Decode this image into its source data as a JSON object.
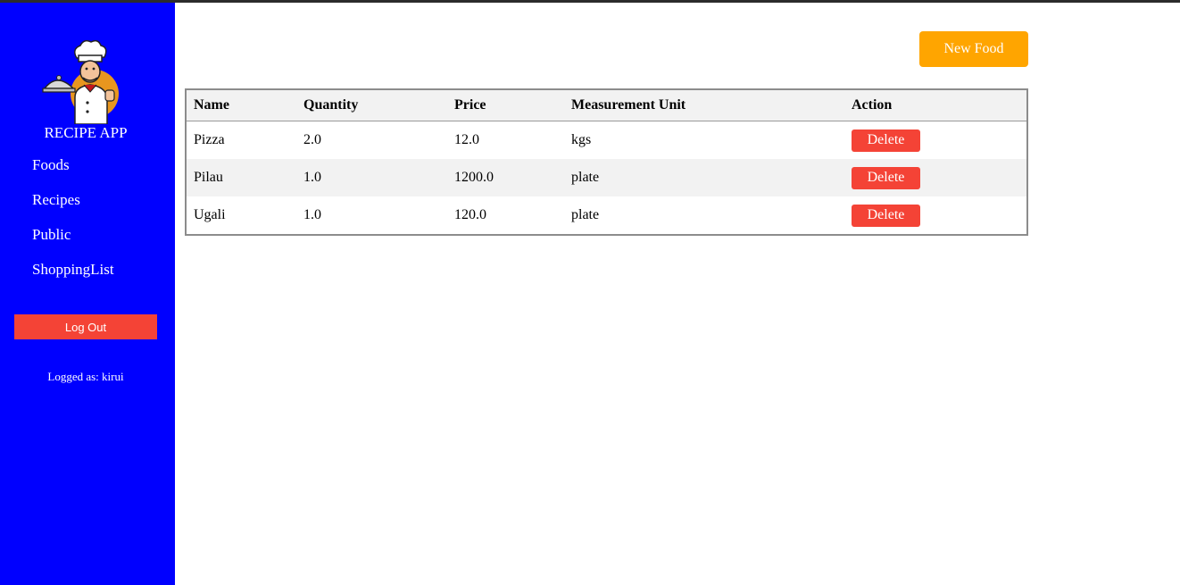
{
  "sidebar": {
    "app_title": "RECIPE APP",
    "logo_icon": "chef-holding-cloche-icon",
    "nav": [
      {
        "label": "Foods"
      },
      {
        "label": "Recipes"
      },
      {
        "label": "Public"
      },
      {
        "label": "ShoppingList"
      }
    ],
    "logout_label": "Log Out",
    "logged_as": "Logged as: kirui"
  },
  "main": {
    "new_food_label": "New Food",
    "table": {
      "headers": [
        "Name",
        "Quantity",
        "Price",
        "Measurement Unit",
        "Action"
      ],
      "rows": [
        {
          "name": "Pizza",
          "quantity": "2.0",
          "price": "12.0",
          "unit": "kgs",
          "action": "Delete"
        },
        {
          "name": "Pilau",
          "quantity": "1.0",
          "price": "1200.0",
          "unit": "plate",
          "action": "Delete"
        },
        {
          "name": "Ugali",
          "quantity": "1.0",
          "price": "120.0",
          "unit": "plate",
          "action": "Delete"
        }
      ]
    }
  },
  "colors": {
    "sidebar_bg": "#0000ff",
    "new_food_bg": "#ffa500",
    "danger": "#f44336"
  }
}
